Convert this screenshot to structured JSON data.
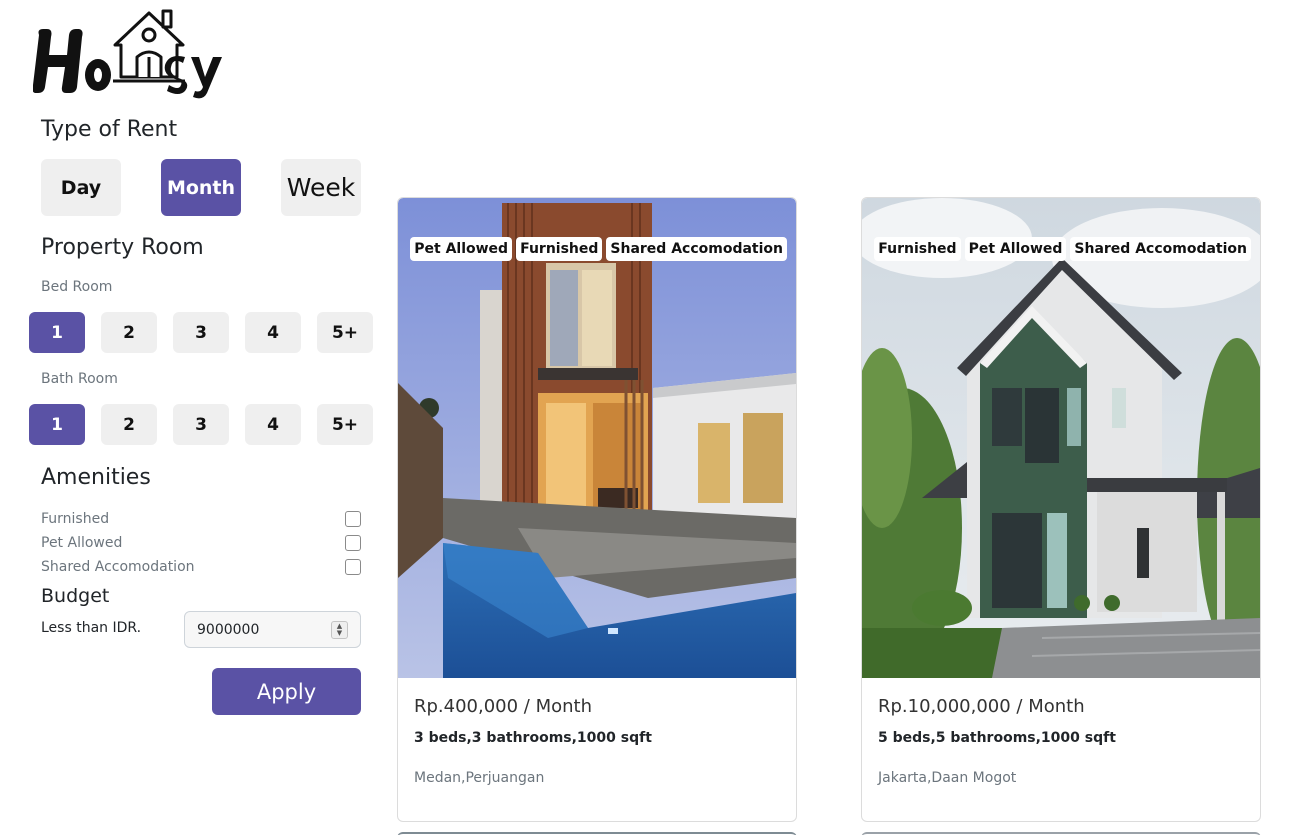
{
  "brand": {
    "name": "Housy"
  },
  "sidebar": {
    "type_of_rent": {
      "title": "Type of Rent",
      "options": [
        "Day",
        "Month",
        "Week"
      ],
      "selected": "Month"
    },
    "property_room": {
      "title": "Property Room",
      "bed": {
        "label": "Bed Room",
        "options": [
          "1",
          "2",
          "3",
          "4",
          "5+"
        ],
        "selected": "1"
      },
      "bath": {
        "label": "Bath Room",
        "options": [
          "1",
          "2",
          "3",
          "4",
          "5+"
        ],
        "selected": "1"
      }
    },
    "amenities": {
      "title": "Amenities",
      "items": [
        {
          "label": "Furnished",
          "checked": false
        },
        {
          "label": "Pet Allowed",
          "checked": false
        },
        {
          "label": "Shared Accomodation",
          "checked": false
        }
      ]
    },
    "budget": {
      "title": "Budget",
      "label": "Less than IDR.",
      "value": "9000000"
    },
    "apply_label": "Apply"
  },
  "listings": [
    {
      "tags": [
        "Pet Allowed",
        "Furnished",
        "Shared Accomodation"
      ],
      "price": "Rp.400,000 / Month",
      "specs": "3 beds,3 bathrooms,1000 sqft",
      "location": "Medan,Perjuangan"
    },
    {
      "tags": [
        "Furnished",
        "Pet Allowed",
        "Shared Accomodation"
      ],
      "price": "Rp.10,000,000 / Month",
      "specs": "5 beds,5 bathrooms,1000 sqft",
      "location": "Jakarta,Daan Mogot"
    }
  ],
  "colors": {
    "accent": "#5a52a5",
    "button_bg": "#efefef"
  }
}
